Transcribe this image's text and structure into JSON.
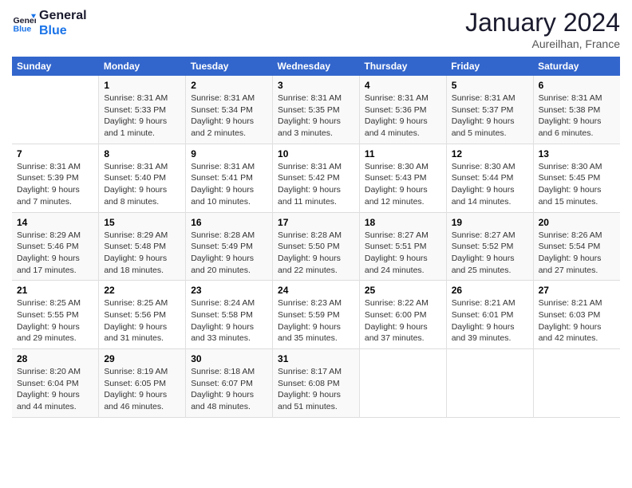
{
  "logo": {
    "line1": "General",
    "line2": "Blue"
  },
  "title": "January 2024",
  "subtitle": "Aureilhan, France",
  "headers": [
    "Sunday",
    "Monday",
    "Tuesday",
    "Wednesday",
    "Thursday",
    "Friday",
    "Saturday"
  ],
  "weeks": [
    [
      {
        "day": "",
        "info": ""
      },
      {
        "day": "1",
        "info": "Sunrise: 8:31 AM\nSunset: 5:33 PM\nDaylight: 9 hours\nand 1 minute."
      },
      {
        "day": "2",
        "info": "Sunrise: 8:31 AM\nSunset: 5:34 PM\nDaylight: 9 hours\nand 2 minutes."
      },
      {
        "day": "3",
        "info": "Sunrise: 8:31 AM\nSunset: 5:35 PM\nDaylight: 9 hours\nand 3 minutes."
      },
      {
        "day": "4",
        "info": "Sunrise: 8:31 AM\nSunset: 5:36 PM\nDaylight: 9 hours\nand 4 minutes."
      },
      {
        "day": "5",
        "info": "Sunrise: 8:31 AM\nSunset: 5:37 PM\nDaylight: 9 hours\nand 5 minutes."
      },
      {
        "day": "6",
        "info": "Sunrise: 8:31 AM\nSunset: 5:38 PM\nDaylight: 9 hours\nand 6 minutes."
      }
    ],
    [
      {
        "day": "7",
        "info": "Sunrise: 8:31 AM\nSunset: 5:39 PM\nDaylight: 9 hours\nand 7 minutes."
      },
      {
        "day": "8",
        "info": "Sunrise: 8:31 AM\nSunset: 5:40 PM\nDaylight: 9 hours\nand 8 minutes."
      },
      {
        "day": "9",
        "info": "Sunrise: 8:31 AM\nSunset: 5:41 PM\nDaylight: 9 hours\nand 10 minutes."
      },
      {
        "day": "10",
        "info": "Sunrise: 8:31 AM\nSunset: 5:42 PM\nDaylight: 9 hours\nand 11 minutes."
      },
      {
        "day": "11",
        "info": "Sunrise: 8:30 AM\nSunset: 5:43 PM\nDaylight: 9 hours\nand 12 minutes."
      },
      {
        "day": "12",
        "info": "Sunrise: 8:30 AM\nSunset: 5:44 PM\nDaylight: 9 hours\nand 14 minutes."
      },
      {
        "day": "13",
        "info": "Sunrise: 8:30 AM\nSunset: 5:45 PM\nDaylight: 9 hours\nand 15 minutes."
      }
    ],
    [
      {
        "day": "14",
        "info": "Sunrise: 8:29 AM\nSunset: 5:46 PM\nDaylight: 9 hours\nand 17 minutes."
      },
      {
        "day": "15",
        "info": "Sunrise: 8:29 AM\nSunset: 5:48 PM\nDaylight: 9 hours\nand 18 minutes."
      },
      {
        "day": "16",
        "info": "Sunrise: 8:28 AM\nSunset: 5:49 PM\nDaylight: 9 hours\nand 20 minutes."
      },
      {
        "day": "17",
        "info": "Sunrise: 8:28 AM\nSunset: 5:50 PM\nDaylight: 9 hours\nand 22 minutes."
      },
      {
        "day": "18",
        "info": "Sunrise: 8:27 AM\nSunset: 5:51 PM\nDaylight: 9 hours\nand 24 minutes."
      },
      {
        "day": "19",
        "info": "Sunrise: 8:27 AM\nSunset: 5:52 PM\nDaylight: 9 hours\nand 25 minutes."
      },
      {
        "day": "20",
        "info": "Sunrise: 8:26 AM\nSunset: 5:54 PM\nDaylight: 9 hours\nand 27 minutes."
      }
    ],
    [
      {
        "day": "21",
        "info": "Sunrise: 8:25 AM\nSunset: 5:55 PM\nDaylight: 9 hours\nand 29 minutes."
      },
      {
        "day": "22",
        "info": "Sunrise: 8:25 AM\nSunset: 5:56 PM\nDaylight: 9 hours\nand 31 minutes."
      },
      {
        "day": "23",
        "info": "Sunrise: 8:24 AM\nSunset: 5:58 PM\nDaylight: 9 hours\nand 33 minutes."
      },
      {
        "day": "24",
        "info": "Sunrise: 8:23 AM\nSunset: 5:59 PM\nDaylight: 9 hours\nand 35 minutes."
      },
      {
        "day": "25",
        "info": "Sunrise: 8:22 AM\nSunset: 6:00 PM\nDaylight: 9 hours\nand 37 minutes."
      },
      {
        "day": "26",
        "info": "Sunrise: 8:21 AM\nSunset: 6:01 PM\nDaylight: 9 hours\nand 39 minutes."
      },
      {
        "day": "27",
        "info": "Sunrise: 8:21 AM\nSunset: 6:03 PM\nDaylight: 9 hours\nand 42 minutes."
      }
    ],
    [
      {
        "day": "28",
        "info": "Sunrise: 8:20 AM\nSunset: 6:04 PM\nDaylight: 9 hours\nand 44 minutes."
      },
      {
        "day": "29",
        "info": "Sunrise: 8:19 AM\nSunset: 6:05 PM\nDaylight: 9 hours\nand 46 minutes."
      },
      {
        "day": "30",
        "info": "Sunrise: 8:18 AM\nSunset: 6:07 PM\nDaylight: 9 hours\nand 48 minutes."
      },
      {
        "day": "31",
        "info": "Sunrise: 8:17 AM\nSunset: 6:08 PM\nDaylight: 9 hours\nand 51 minutes."
      },
      {
        "day": "",
        "info": ""
      },
      {
        "day": "",
        "info": ""
      },
      {
        "day": "",
        "info": ""
      }
    ]
  ]
}
